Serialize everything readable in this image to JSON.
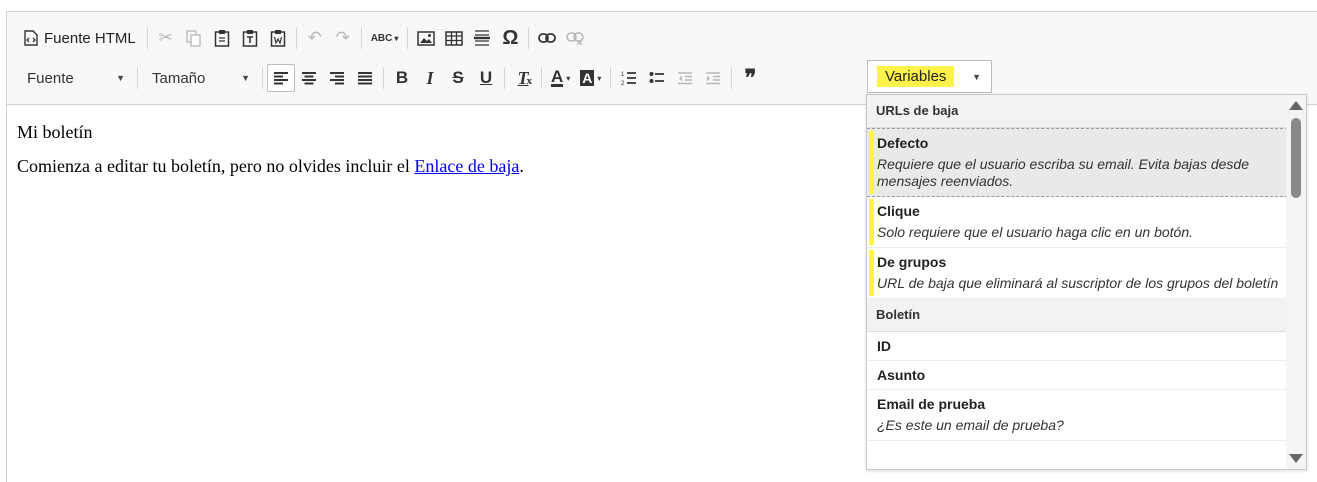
{
  "toolbar": {
    "source_label": "Fuente HTML",
    "font_combo": "Fuente",
    "size_combo": "Tamaño",
    "variables_combo": "Variables",
    "icons": {
      "cut": "✂",
      "undo": "↶",
      "redo": "↷",
      "spell": "ABC",
      "special_char": "Ω",
      "bold": "B",
      "italic": "I",
      "strike": "S",
      "underline": "U",
      "remove_format": "T",
      "text_color": "A",
      "bg_color": "A",
      "quote": "❞"
    }
  },
  "content": {
    "title": "Mi boletín",
    "text_before_link": "Comienza a editar tu boletín, pero no olvides incluir el ",
    "link_text": "Enlace de baja",
    "text_after_link": "."
  },
  "dropdown": {
    "groups": [
      {
        "heading": "URLs de baja",
        "items": [
          {
            "title": "Defecto",
            "desc": "Requiere que el usuario escriba su email. Evita bajas desde mensajes reenviados."
          },
          {
            "title": "Clique",
            "desc": "Solo requiere que el usuario haga clic en un botón."
          },
          {
            "title": "De grupos",
            "desc": "URL de baja que eliminará al suscriptor de los grupos del boletín"
          }
        ]
      },
      {
        "heading": "Boletín",
        "items": [
          {
            "title": "ID"
          },
          {
            "title": "Asunto"
          },
          {
            "title": "Email de prueba",
            "desc": "¿Es este un email de prueba?"
          }
        ]
      }
    ]
  },
  "colors": {
    "highlight": "#fff24a",
    "link": "#0000ee",
    "toolbar_bg": "#f8f8f8"
  }
}
